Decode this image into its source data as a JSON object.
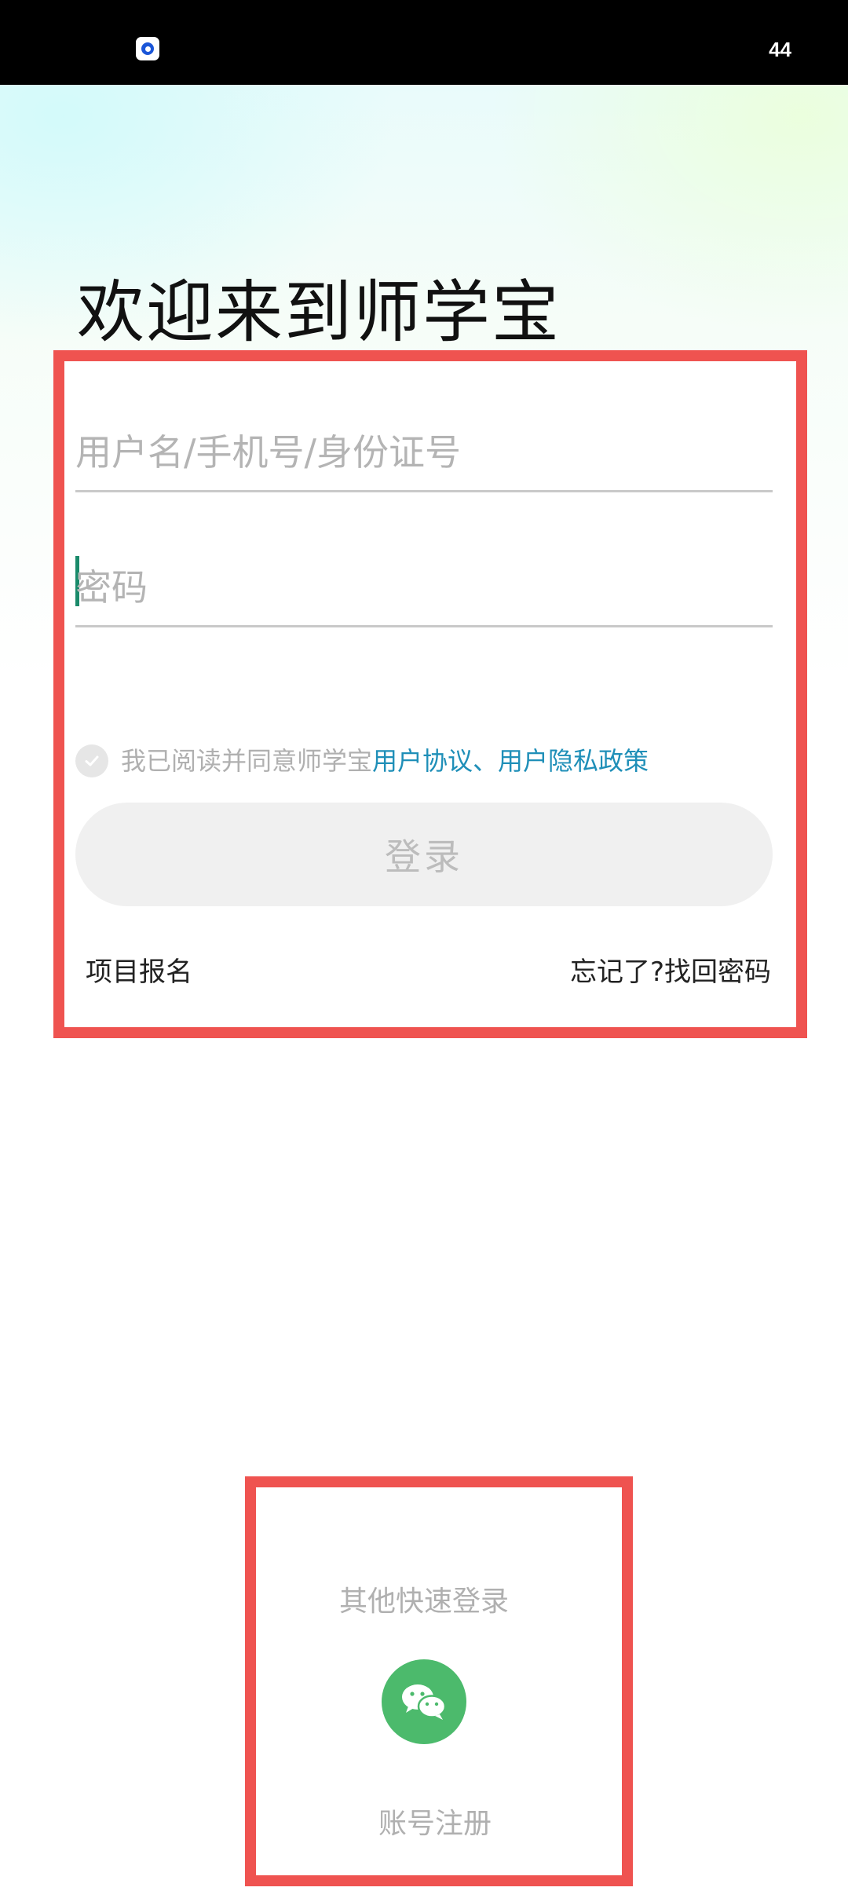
{
  "status_bar": {
    "battery": "44"
  },
  "page": {
    "title": "欢迎来到师学宝"
  },
  "login_form": {
    "username_placeholder": "用户名/手机号/身份证号",
    "password_placeholder": "密码",
    "agreement_prefix": "我已阅读并同意师学宝",
    "agreement_links": "用户协议、用户隐私政策",
    "login_label": "登录",
    "project_signup": "项目报名",
    "forgot_password": "忘记了?找回密码"
  },
  "quick_login": {
    "title": "其他快速登录",
    "wechat_icon": "wechat-icon",
    "register_label": "账号注册"
  },
  "colors": {
    "highlight_border": "#ef5350",
    "link": "#1f8fb8",
    "wechat": "#4cba6c",
    "cursor": "#1a8a6a"
  }
}
